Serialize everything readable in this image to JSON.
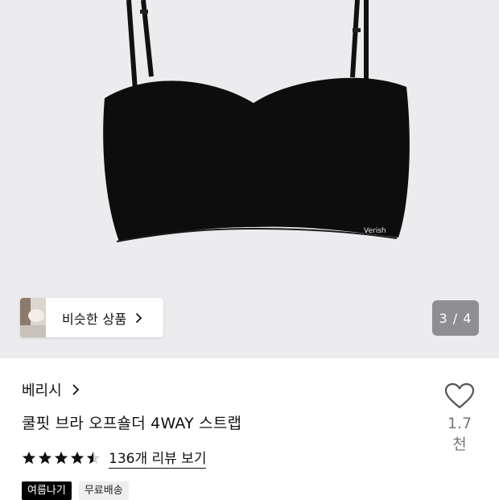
{
  "gallery": {
    "similar_label": "비슷한 상품",
    "counter": "3 / 4"
  },
  "product": {
    "brand": "베리시",
    "title": "쿨핏 브라 오프숄더 4WAY 스트랩",
    "logo_text": "Verish",
    "wish_count": "1.7천",
    "rating": 4.5,
    "reviews_label": "136개 리뷰 보기",
    "tags": [
      "여름나기",
      "무료배송"
    ]
  },
  "colors": {
    "hero_bg": "#ececee",
    "product": "#0d0d0e",
    "counter_bg": "#8e8e93"
  }
}
